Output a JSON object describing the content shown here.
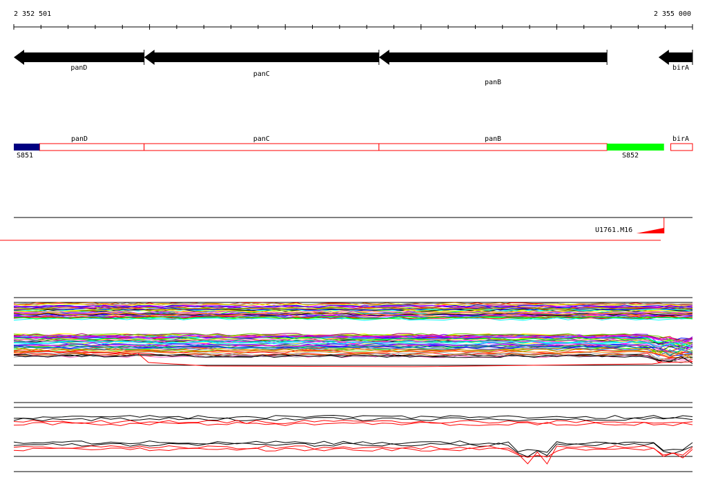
{
  "ruler": {
    "start_label": "2 352 501",
    "end_label": "2 355 000",
    "start": 2352501,
    "end": 2355000
  },
  "genes": [
    {
      "name": "panD",
      "start": 2352500,
      "end": 2352980,
      "strand": "-"
    },
    {
      "name": "panC",
      "start": 2352980,
      "end": 2353845,
      "strand": "-"
    },
    {
      "name": "panB",
      "start": 2353845,
      "end": 2354685,
      "strand": "-"
    },
    {
      "name": "birA",
      "start": 2354875,
      "end": 2355000,
      "strand": "-"
    }
  ],
  "segments": [
    {
      "name": "S851",
      "start": 2352500,
      "end": 2352595,
      "color": "#000080"
    },
    {
      "name": "S852",
      "start": 2354685,
      "end": 2354895,
      "color": "#00ff00"
    }
  ],
  "operon_boxes": [
    {
      "name": "panD",
      "start": 2352595,
      "end": 2352980
    },
    {
      "name": "panC",
      "start": 2352980,
      "end": 2353845
    },
    {
      "name": "panB",
      "start": 2353845,
      "end": 2354685
    },
    {
      "name": "birA",
      "start": 2354920,
      "end": 2355000
    }
  ],
  "transcript": {
    "name": "U1761.M16",
    "end": 2354895
  },
  "colors": {
    "gene_arrow": "#000000",
    "operon_outline": "#ff0000",
    "transcript": "#ff0000",
    "track_border": "#000000"
  }
}
